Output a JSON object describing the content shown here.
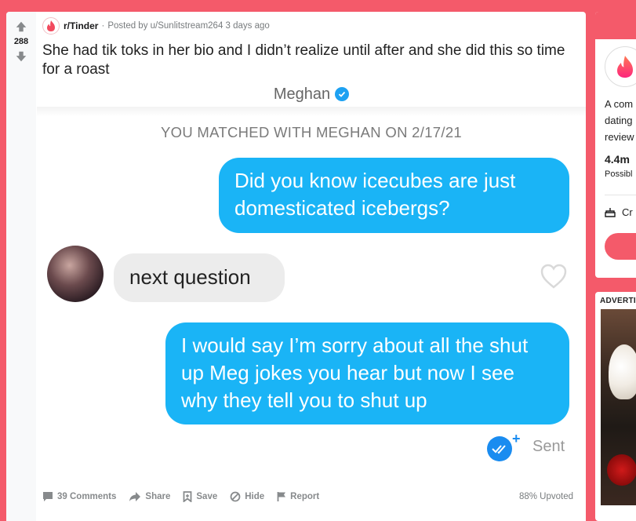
{
  "post": {
    "score": "288",
    "subreddit": "r/Tinder",
    "separator": "·",
    "posted_by": "Posted by u/Sunlitstream264 3 days ago",
    "title": "She had tik toks in her bio and I didn’t realize until after and she did this so time for a roast"
  },
  "screenshot": {
    "header_name": "Meghan",
    "matched_text": "YOU MATCHED WITH MEGHAN ON 2/17/21",
    "messages": [
      {
        "from": "me",
        "text": "Did you know icecubes are just domesticated icebergs?"
      },
      {
        "from": "them",
        "text": "next question"
      },
      {
        "from": "me",
        "text": "I would say I’m sorry about all the shut up Meg jokes you hear but now I see why they tell you to shut up"
      }
    ],
    "plus": "+",
    "status": "Sent"
  },
  "actions": {
    "comments": "39 Comments",
    "share": "Share",
    "save": "Save",
    "hide": "Hide",
    "report": "Report",
    "upvoted": "88% Upvoted"
  },
  "sidebar": {
    "description": "A com\ndating\nreview",
    "members": "4.4m",
    "members_label": "Possibl",
    "created": "Cr"
  },
  "ad": {
    "label": "ADVERTI"
  },
  "colors": {
    "background": "#f45a6a",
    "bubble_out": "#1ab4f6",
    "bubble_in": "#ececec",
    "verified": "#1da1f2"
  }
}
